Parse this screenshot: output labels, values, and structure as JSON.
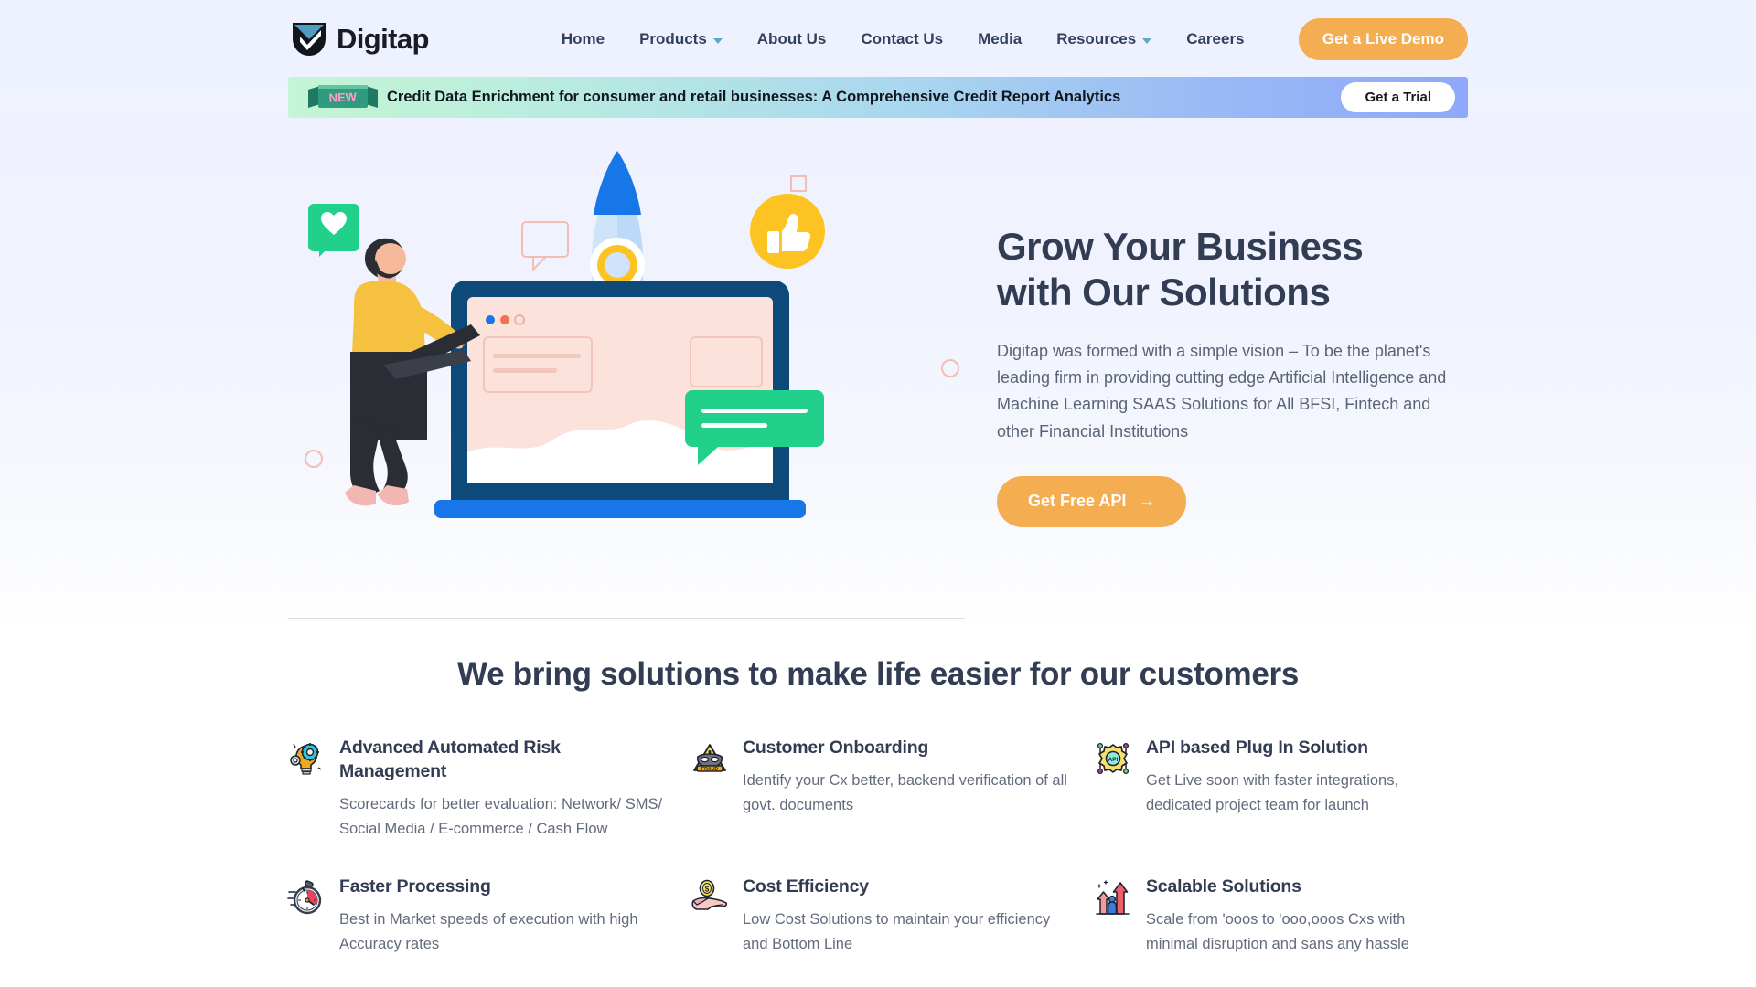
{
  "brand": {
    "name": "Digitap",
    "logo_icon": "digitap-checkmark-logo"
  },
  "nav": {
    "links": [
      {
        "label": "Home",
        "has_dropdown": false
      },
      {
        "label": "Products",
        "has_dropdown": true
      },
      {
        "label": "About Us",
        "has_dropdown": false
      },
      {
        "label": "Contact Us",
        "has_dropdown": false
      },
      {
        "label": "Media",
        "has_dropdown": false
      },
      {
        "label": "Resources",
        "has_dropdown": true
      },
      {
        "label": "Careers",
        "has_dropdown": false
      }
    ],
    "cta_label": "Get a Live Demo"
  },
  "banner": {
    "badge": "NEW",
    "text": "Credit Data Enrichment for consumer and retail businesses: A Comprehensive Credit Report Analytics",
    "cta_label": "Get a Trial"
  },
  "hero": {
    "title_line1": "Grow Your Business",
    "title_line2": "with Our Solutions",
    "paragraph": "Digitap was formed with a simple vision – To be the planet's leading firm in providing cutting edge Artificial Intelligence and Machine Learning SAAS Solutions for All BFSI, Fintech and other Financial Institutions",
    "cta_label": "Get Free API",
    "cta_arrow": "→",
    "illustration": "rocket-launch-laptop-developer-illustration"
  },
  "solutions": {
    "heading": "We bring solutions to make life easier for our customers",
    "features": [
      {
        "icon": "lightbulb-gear-icon",
        "title": "Advanced Automated Risk Management",
        "desc": "Scorecards for better evaluation: Network/ SMS/ Social Media / E-commerce / Cash Flow"
      },
      {
        "icon": "fraud-mask-warning-icon",
        "title": "Customer Onboarding",
        "desc": "Identify your Cx better, backend verification of all govt. documents"
      },
      {
        "icon": "api-gear-node-icon",
        "title": "API based Plug In Solution",
        "desc": "Get Live soon with faster integrations, dedicated project team for launch"
      },
      {
        "icon": "stopwatch-icon",
        "title": "Faster Processing",
        "desc": "Best in Market speeds of execution with high Accuracy rates"
      },
      {
        "icon": "coin-in-hand-icon",
        "title": "Cost Efficiency",
        "desc": "Low Cost Solutions to maintain your efficiency and Bottom Line"
      },
      {
        "icon": "growth-arrows-people-icon",
        "title": "Scalable Solutions",
        "desc": "Scale from 'ooos to 'ooo,ooos Cxs with minimal disruption and sans any hassle"
      }
    ]
  },
  "colors": {
    "accent_orange": "#f5ad52",
    "text_dark": "#323c52",
    "text_muted": "#626b7d",
    "logo_blue": "#4f9cc4",
    "hero_bg": "#eef2ff"
  }
}
